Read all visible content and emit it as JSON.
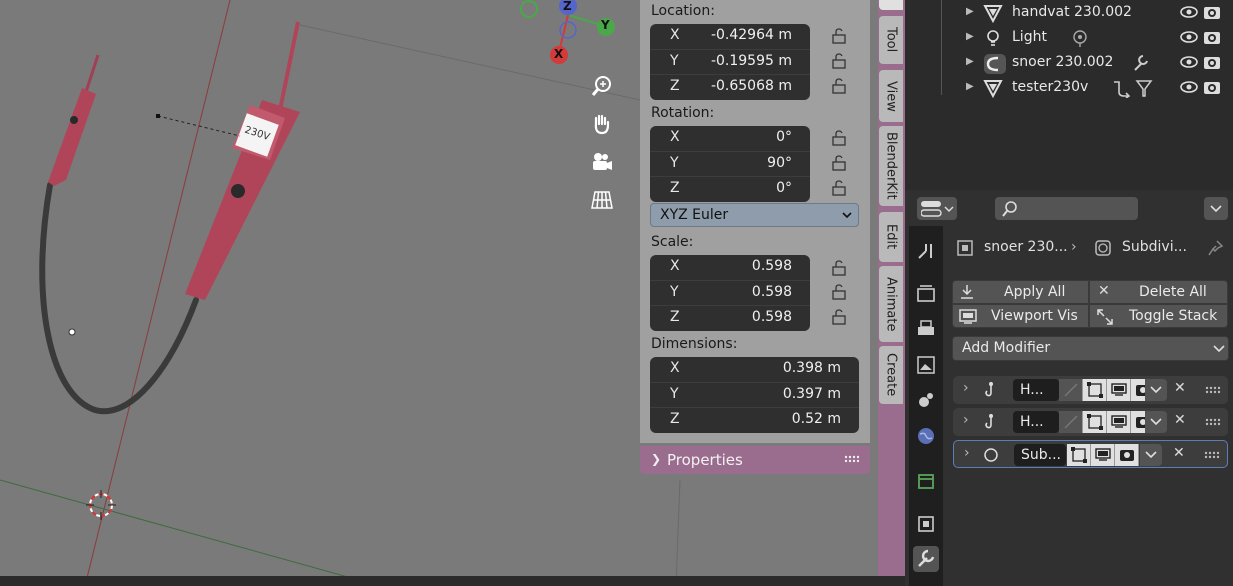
{
  "viewport": {
    "label_230v": "230V",
    "gizmo": {
      "y_label": "Y",
      "x_label": "X",
      "z_label": "Z"
    },
    "nav_icons": [
      "zoom-icon",
      "hand-pan-icon",
      "camera-icon",
      "grid-ortho-icon"
    ]
  },
  "transform": {
    "location_label": "Location:",
    "location": [
      {
        "axis": "X",
        "value": "-0.42964 m"
      },
      {
        "axis": "Y",
        "value": "-0.19595 m"
      },
      {
        "axis": "Z",
        "value": "-0.65068 m"
      }
    ],
    "rotation_label": "Rotation:",
    "rotation": [
      {
        "axis": "X",
        "value": "0°"
      },
      {
        "axis": "Y",
        "value": "90°"
      },
      {
        "axis": "Z",
        "value": "0°"
      }
    ],
    "rotation_mode": "XYZ Euler",
    "scale_label": "Scale:",
    "scale": [
      {
        "axis": "X",
        "value": "0.598"
      },
      {
        "axis": "Y",
        "value": "0.598"
      },
      {
        "axis": "Z",
        "value": "0.598"
      }
    ],
    "dimensions_label": "Dimensions:",
    "dimensions": [
      {
        "axis": "X",
        "value": "0.398 m"
      },
      {
        "axis": "Y",
        "value": "0.397 m"
      },
      {
        "axis": "Z",
        "value": "0.52 m"
      }
    ],
    "properties_label": "Properties"
  },
  "sidebar_tabs": [
    "Tool",
    "View",
    "BlenderKit",
    "Edit",
    "Animate",
    "Create"
  ],
  "outliner": {
    "items": [
      {
        "name": "handvat 230.002",
        "icon": "mesh-icon"
      },
      {
        "name": "Light",
        "icon": "light-icon"
      },
      {
        "name": "snoer 230.002",
        "icon": "curve-icon"
      },
      {
        "name": "tester230v",
        "icon": "mesh-icon"
      }
    ]
  },
  "properties": {
    "breadcrumb_object": "snoer 230...",
    "breadcrumb_modifier": "Subdivi...",
    "apply_all": "Apply All",
    "delete_all": "Delete All",
    "viewport_vis": "Viewport Vis",
    "toggle_stack": "Toggle Stack",
    "add_modifier": "Add Modifier",
    "modifiers": [
      {
        "name": "H...",
        "icon": "hook-icon"
      },
      {
        "name": "H...",
        "icon": "hook-icon"
      },
      {
        "name": "Sub...",
        "icon": "subdivision-icon"
      }
    ]
  },
  "colors": {
    "viewport_bg": "#7a7a7a",
    "sidebar_tab_accent": "#9a6c8e",
    "tester_red": "#b0455a"
  }
}
